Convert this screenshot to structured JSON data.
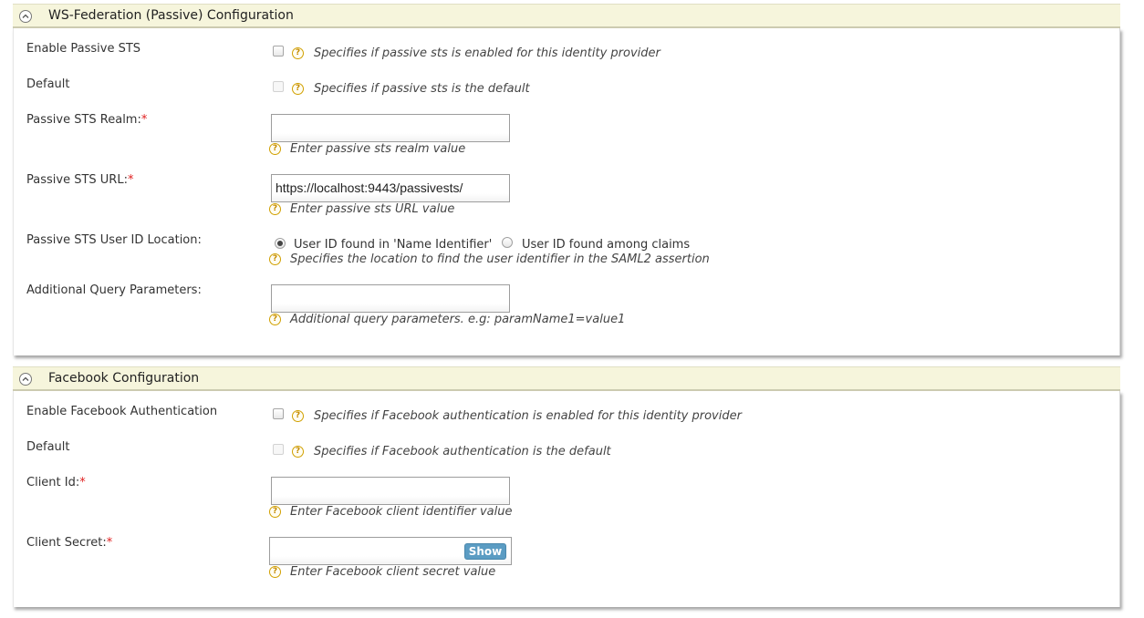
{
  "wsfed": {
    "title": "WS-Federation (Passive) Configuration",
    "enable_label": "Enable Passive STS",
    "enable_help": "Specifies if passive sts is enabled for this identity provider",
    "default_label": "Default",
    "default_help": "Specifies if passive sts is the default",
    "realm_label": "Passive STS Realm:",
    "realm_value": "",
    "realm_help": "Enter passive sts realm value",
    "url_label": "Passive STS URL:",
    "url_value": "https://localhost:9443/passivests/",
    "url_help": "Enter passive sts URL value",
    "userid_label": "Passive STS User ID Location:",
    "userid_option_1": "User ID found in 'Name Identifier'",
    "userid_option_2": "User ID found among claims",
    "userid_selected": "User ID found in 'Name Identifier'",
    "userid_help": "Specifies the location to find the user identifier in the SAML2 assertion",
    "query_label": "Additional Query Parameters:",
    "query_value": "",
    "query_help": "Additional query parameters. e.g: paramName1=value1"
  },
  "facebook": {
    "title": "Facebook Configuration",
    "enable_label": "Enable Facebook Authentication",
    "enable_help": "Specifies if Facebook authentication is enabled for this identity provider",
    "default_label": "Default",
    "default_help": "Specifies if Facebook authentication is the default",
    "client_id_label": "Client Id:",
    "client_id_value": "",
    "client_id_help": "Enter Facebook client identifier value",
    "client_secret_label": "Client Secret:",
    "client_secret_value": "",
    "show_button": "Show",
    "client_secret_help": "Enter Facebook client secret value"
  },
  "common": {
    "required_marker": "*",
    "help_glyph": "?"
  },
  "colors": {
    "header_bg": "#f6f5dc",
    "required": "#e02020",
    "help_icon": "#d1a000",
    "show_button": "#5b9cc3"
  }
}
